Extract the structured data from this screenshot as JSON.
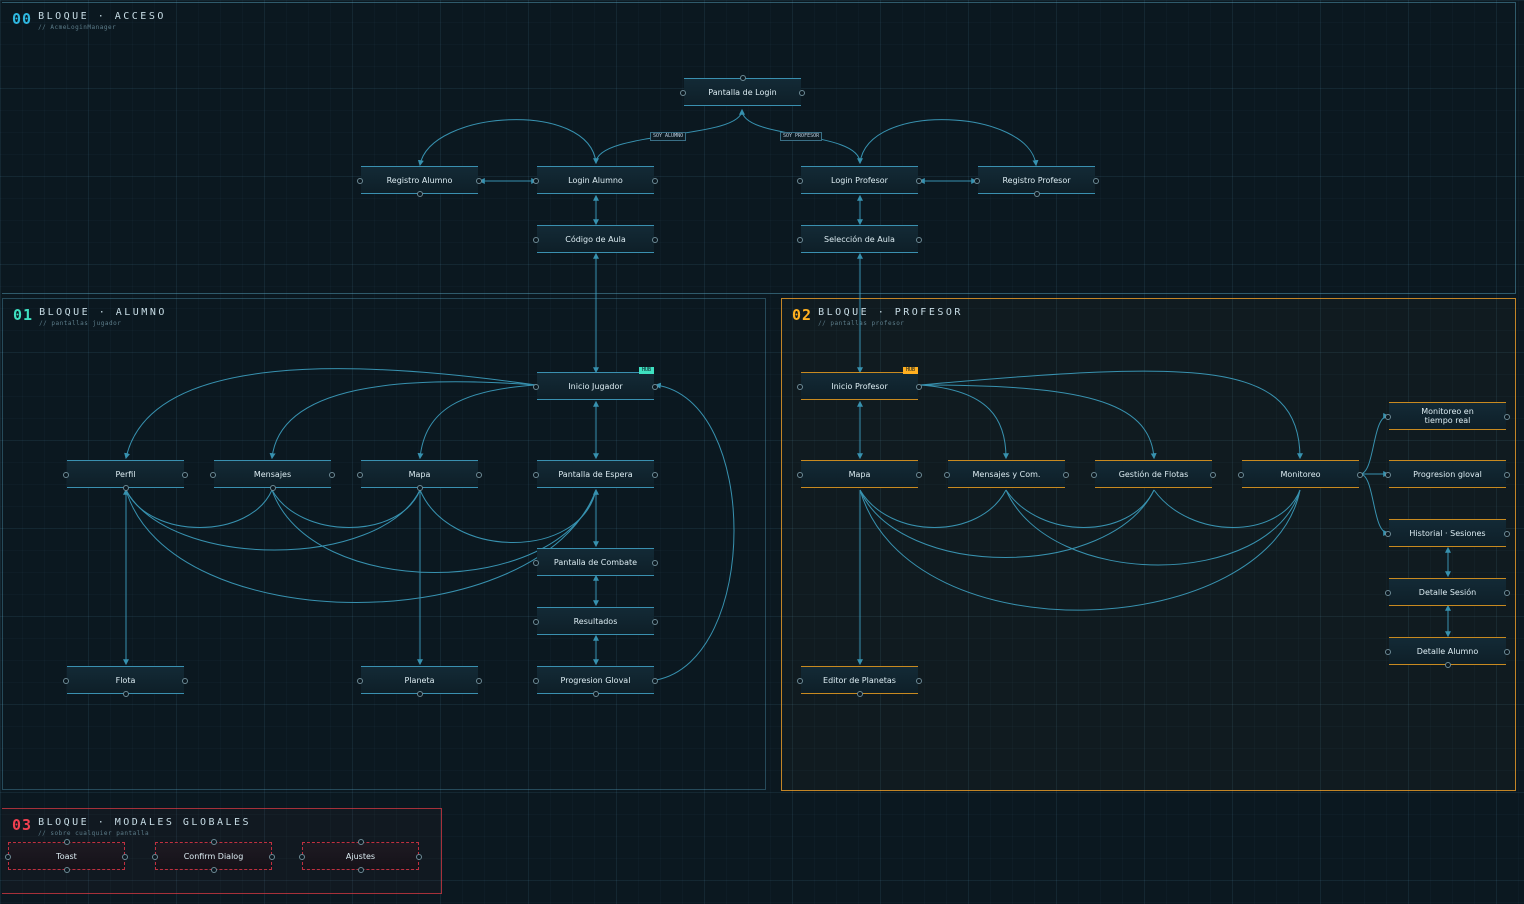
{
  "blocks": [
    {
      "num": "00",
      "title": "BLOQUE · ACCESO",
      "sub": "// AcmeLoginManager"
    },
    {
      "num": "01",
      "title": "BLOQUE · ALUMNO",
      "sub": "// pantallas jugador"
    },
    {
      "num": "02",
      "title": "BLOQUE · PROFESOR",
      "sub": "// pantallas profesor"
    },
    {
      "num": "03",
      "title": "BLOQUE · MODALES GLOBALES",
      "sub": "// sobre cualquier pantalla"
    }
  ],
  "nodes": {
    "login": "Pantalla de Login",
    "registro_alumno": "Registro Alumno",
    "login_alumno": "Login Alumno",
    "login_profesor": "Login Profesor",
    "registro_profesor": "Registro Profesor",
    "codigo_aula": "Código de Aula",
    "seleccion_aula": "Selección de Aula",
    "inicio_jugador": "Inicio Jugador",
    "perfil": "Perfil",
    "mensajes": "Mensajes",
    "mapa_alumno": "Mapa",
    "pantalla_espera": "Pantalla de Espera",
    "pantalla_combate": "Pantalla de Combate",
    "resultados": "Resultados",
    "progresion_alumno": "Progresion Gloval",
    "flota": "Flota",
    "planeta": "Planeta",
    "inicio_profesor": "Inicio Profesor",
    "mapa_profesor": "Mapa",
    "mensajes_com": "Mensajes y Com.",
    "gestion_flotas": "Gestión de Flotas",
    "monitoreo": "Monitoreo",
    "monitoreo_tiempo_real": "Monitoreo en tiempo real",
    "progresion_profesor": "Progresion gloval",
    "historial_sesiones": "Historial · Sesiones",
    "detalle_sesion": "Detalle Sesión",
    "detalle_alumno": "Detalle Alumno",
    "editor_planetas": "Editor de Planetas",
    "toast": "Toast",
    "confirm_dialog": "Confirm Dialog",
    "ajustes": "Ajustes"
  },
  "edge_labels": {
    "soy_alumno": "SOY ALUMNO",
    "soy_profesor": "SOY PROFESOR"
  },
  "badges": {
    "jugador": "HUB",
    "profesor": "HUB"
  },
  "colors": {
    "wire": "#3fa7c9",
    "alumno": "#3ee0c0",
    "profesor": "#ffb020",
    "modal": "#f04050",
    "acceso": "#2fb8e0"
  }
}
